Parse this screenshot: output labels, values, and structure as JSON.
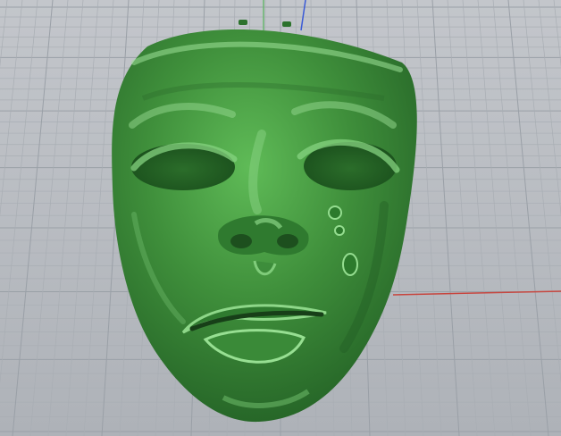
{
  "viewport": {
    "background_color": "#b4b8bd",
    "grid_major_color": "#9aa0a7",
    "grid_minor_color": "#a9aeb4",
    "x_axis_color": "#c7463f",
    "y_axis_color": "#69b66f",
    "z_axis_color": "#3b5bd6"
  },
  "model": {
    "name": "tragedy-mask",
    "base_color": "#3f8f3b",
    "highlight_color": "#7fd27a",
    "shadow_color": "#1f5a22"
  },
  "icons": {
    "axis_gizmo": "axis-icon"
  }
}
